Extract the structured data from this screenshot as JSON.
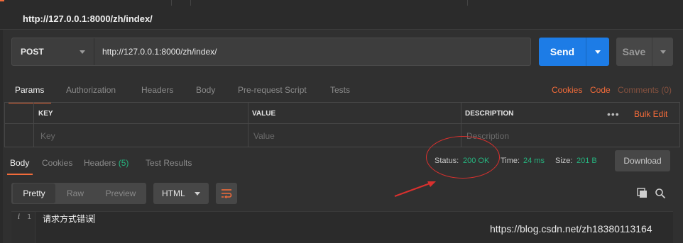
{
  "tab": {
    "title": "http://127.0.0.1:8000/zh/index/"
  },
  "request": {
    "method": "POST",
    "url": "http://127.0.0.1:8000/zh/index/",
    "send_label": "Send",
    "save_label": "Save"
  },
  "request_tabs": [
    {
      "label": "Params"
    },
    {
      "label": "Authorization"
    },
    {
      "label": "Headers"
    },
    {
      "label": "Body"
    },
    {
      "label": "Pre-request Script"
    },
    {
      "label": "Tests"
    }
  ],
  "request_links": {
    "cookies": "Cookies",
    "code": "Code",
    "comments": "Comments (0)"
  },
  "params": {
    "headers": {
      "key": "KEY",
      "value": "VALUE",
      "description": "DESCRIPTION"
    },
    "bulk_edit": "Bulk Edit",
    "more": "•••",
    "placeholders": {
      "key": "Key",
      "value": "Value",
      "description": "Description"
    }
  },
  "response_tabs": [
    {
      "label": "Body"
    },
    {
      "label": "Cookies"
    },
    {
      "label": "Headers"
    },
    {
      "label": "Test Results"
    }
  ],
  "response_headers_count": "(5)",
  "response_status": {
    "status_label": "Status:",
    "status_value": "200 OK",
    "time_label": "Time:",
    "time_value": "24 ms",
    "size_label": "Size:",
    "size_value": "201 B"
  },
  "download_label": "Download",
  "view_modes": [
    "Pretty",
    "Raw",
    "Preview"
  ],
  "format_select": "HTML",
  "editor": {
    "info_icon": "i",
    "line_number": "1",
    "line_text": "请求方式错误"
  },
  "watermark": "https://blog.csdn.net/zh18380113164",
  "colors": {
    "accent": "#f26b3a",
    "send": "#1d7ce6",
    "status_ok": "#26b47f",
    "annotation": "#d9302e"
  }
}
